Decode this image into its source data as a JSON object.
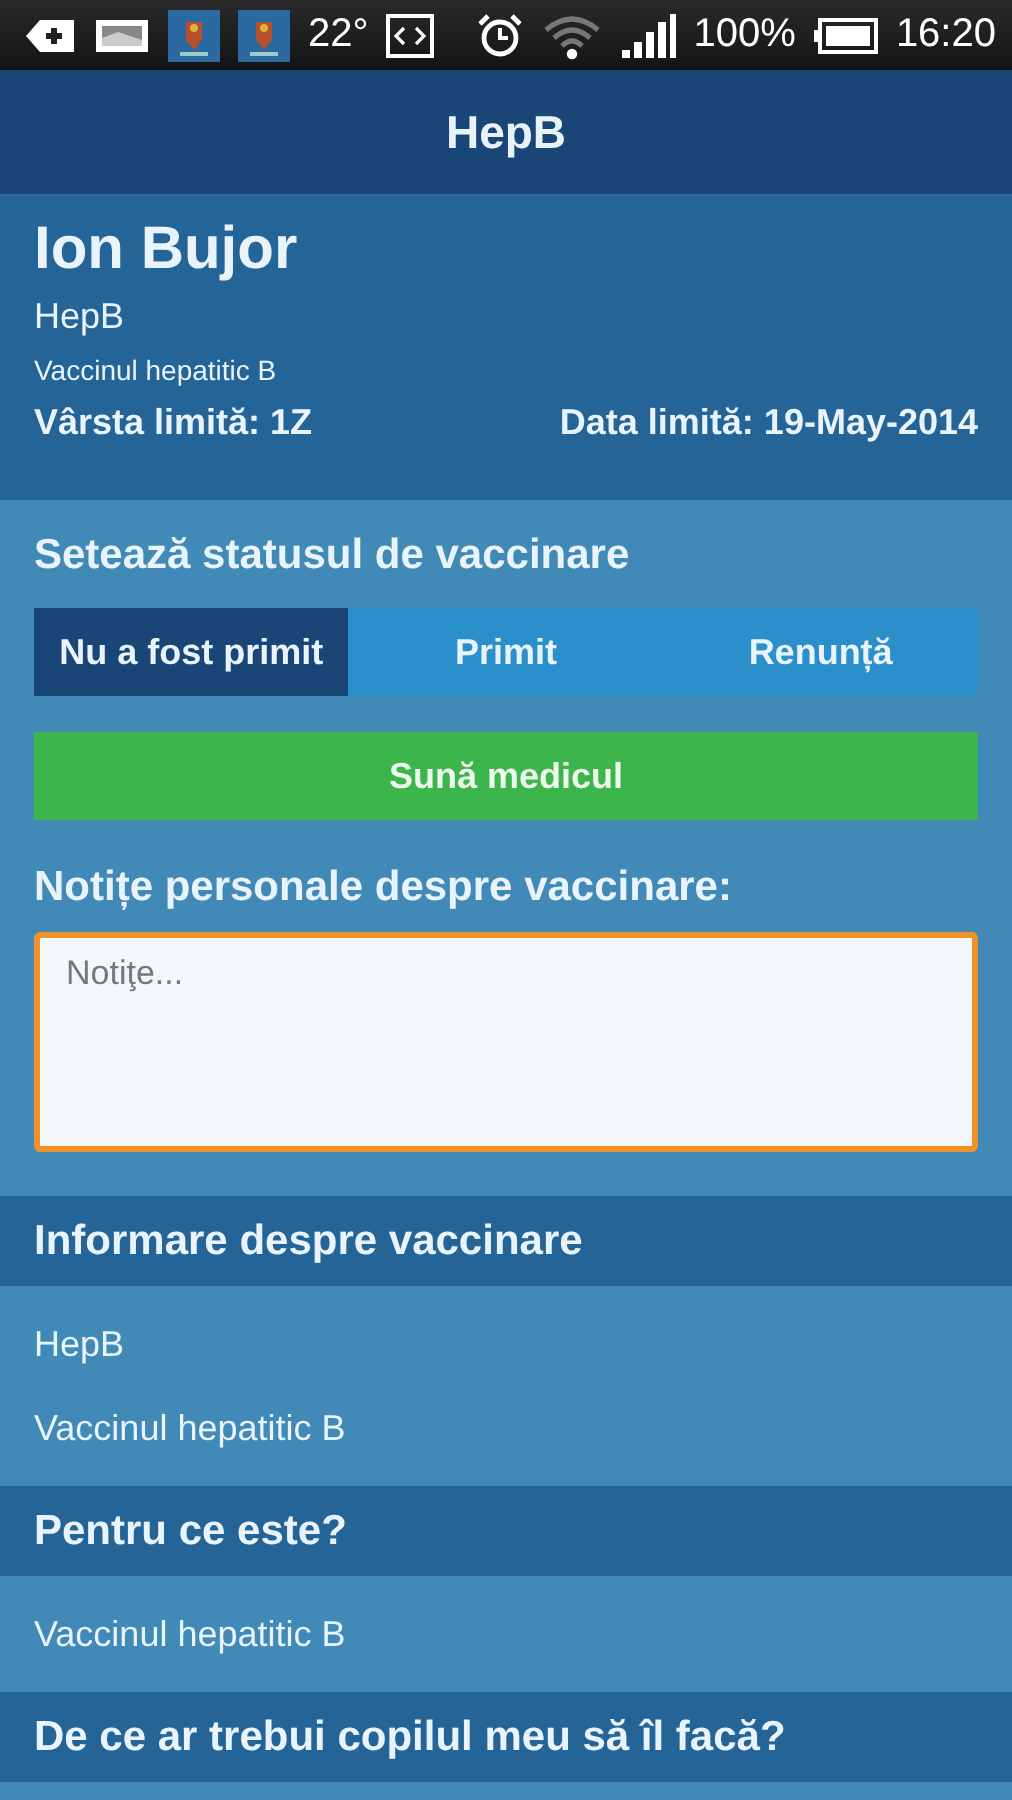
{
  "status_bar": {
    "temperature": "22°",
    "battery": "100%",
    "time": "16:20"
  },
  "app_bar": {
    "title": "HepB"
  },
  "header": {
    "name": "Ion Bujor",
    "vaccine": "HepB",
    "description": "Vaccinul hepatitic B",
    "age_limit": "Vârsta limită: 1Z",
    "date_limit": "Data limită: 19-May-2014"
  },
  "status_section": {
    "title": "Setează statusul de vaccinare",
    "options": [
      {
        "label": "Nu a fost primit",
        "selected": true
      },
      {
        "label": "Primit",
        "selected": false
      },
      {
        "label": "Renunță",
        "selected": false
      }
    ],
    "call_button": "Sună medicul",
    "notes_label": "Notițe personale despre vaccinare:",
    "notes": {
      "placeholder": "Notiţe..."
    }
  },
  "sections": [
    {
      "title": "Informare despre vaccinare",
      "lines": [
        "HepB",
        "Vaccinul hepatitic B"
      ]
    },
    {
      "title": "Pentru ce este?",
      "lines": [
        "Vaccinul hepatitic B"
      ]
    },
    {
      "title": "De ce ar trebui copilul meu să îl facă?"
    }
  ]
}
